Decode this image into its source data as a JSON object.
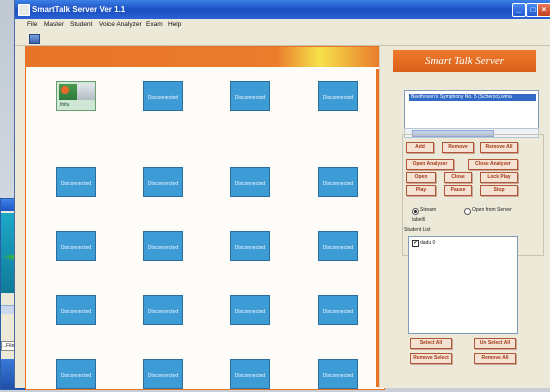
{
  "window": {
    "title": "SmartTalk Server Ver 1.1",
    "controls": {
      "min": "_",
      "max": "□",
      "close": "×"
    }
  },
  "menu": [
    "File",
    "Master",
    "Student",
    "Voice Analyzer",
    "Exam",
    "Help"
  ],
  "panel_title": "Smart Talk Server",
  "clients": [
    {
      "label": "thitu",
      "connected": true
    },
    {
      "label": "Disconnected",
      "connected": false
    },
    {
      "label": "Disconnected",
      "connected": false
    },
    {
      "label": "Disconnected",
      "connected": false
    },
    {
      "label": "Disconnected",
      "connected": false
    },
    {
      "label": "Disconnected",
      "connected": false
    },
    {
      "label": "Disconnected",
      "connected": false
    },
    {
      "label": "Disconnected",
      "connected": false
    },
    {
      "label": "Disconnected",
      "connected": false
    },
    {
      "label": "Disconnected",
      "connected": false
    },
    {
      "label": "Disconnected",
      "connected": false
    },
    {
      "label": "Disconnected",
      "connected": false
    },
    {
      "label": "Disconnected",
      "connected": false
    },
    {
      "label": "Disconnected",
      "connected": false
    },
    {
      "label": "Disconnected",
      "connected": false
    },
    {
      "label": "Disconnected",
      "connected": false
    },
    {
      "label": "Disconnected",
      "connected": false
    },
    {
      "label": "Disconnected",
      "connected": false
    },
    {
      "label": "Disconnected",
      "connected": false
    },
    {
      "label": "Disconnected",
      "connected": false
    }
  ],
  "music_list": {
    "items": [
      "Beethoven's Symphony No. 5 (Scherzo).wma"
    ],
    "selected": 0
  },
  "buttons": {
    "add": "Add",
    "remove": "Remove",
    "remove_all": "Remove All",
    "open_analyzer": "Open Analyzer",
    "close_analyzer": "Close Analyzer",
    "open": "Open",
    "close": "Close",
    "lock_play": "Lock Play",
    "play": "Play",
    "pause": "Pause",
    "stop": "Stop",
    "select_all": "Select All",
    "unselect_all": "Un Select All",
    "remove_select": "Remove Select",
    "remove_all_bottom": "Remove All"
  },
  "stream_mode": {
    "options": [
      "Stream",
      "Open from Server"
    ],
    "selected": "Stream"
  },
  "label6": "label6",
  "student_list": {
    "heading": "Student List",
    "items": [
      {
        "name": "dadu 0",
        "checked": true
      }
    ]
  },
  "background_window": {
    "file_button": "...File"
  },
  "colors": {
    "accent_orange": "#e8742a",
    "client_blue": "#3d9bd6",
    "button_text": "#a33b1a",
    "titlebar_blue": "#1f55c8"
  }
}
